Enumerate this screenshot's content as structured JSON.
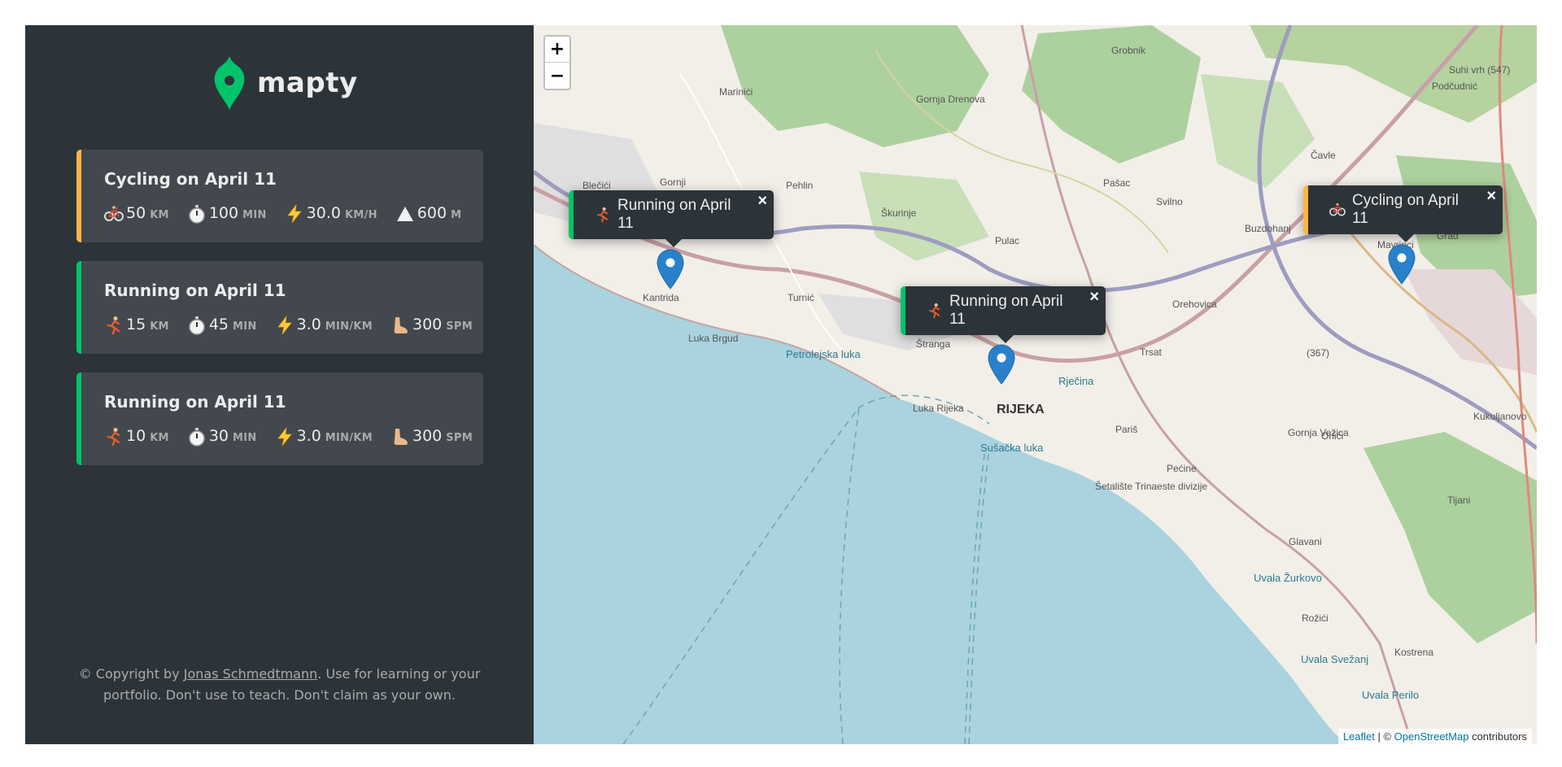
{
  "brand": {
    "name": "mapty"
  },
  "workouts": [
    {
      "type": "cycling",
      "title": "Cycling on April 11",
      "details": [
        {
          "icon": "bicycle-icon",
          "value": "50",
          "unit": "km"
        },
        {
          "icon": "stopwatch-icon",
          "value": "100",
          "unit": "min"
        },
        {
          "icon": "lightning-icon",
          "value": "30.0",
          "unit": "km/h"
        },
        {
          "icon": "mountain-icon",
          "value": "600",
          "unit": "m"
        }
      ]
    },
    {
      "type": "running",
      "title": "Running on April 11",
      "details": [
        {
          "icon": "runner-icon",
          "value": "15",
          "unit": "km"
        },
        {
          "icon": "stopwatch-icon",
          "value": "45",
          "unit": "min"
        },
        {
          "icon": "lightning-icon",
          "value": "3.0",
          "unit": "min/km"
        },
        {
          "icon": "foot-icon",
          "value": "300",
          "unit": "spm"
        }
      ]
    },
    {
      "type": "running",
      "title": "Running on April 11",
      "details": [
        {
          "icon": "runner-icon",
          "value": "10",
          "unit": "km"
        },
        {
          "icon": "stopwatch-icon",
          "value": "30",
          "unit": "min"
        },
        {
          "icon": "lightning-icon",
          "value": "3.0",
          "unit": "min/km"
        },
        {
          "icon": "foot-icon",
          "value": "300",
          "unit": "spm"
        }
      ]
    }
  ],
  "copyright": {
    "prefix": "© Copyright by ",
    "author": "Jonas Schmedtmann",
    "suffix": ". Use for learning or your portfolio. Don't use to teach. Don't claim as your own."
  },
  "map": {
    "zoom_in": "+",
    "zoom_out": "−",
    "popups": [
      {
        "type": "running",
        "label": "Running on April 11",
        "close": "×"
      },
      {
        "type": "running",
        "label": "Running on April 11",
        "close": "×"
      },
      {
        "type": "cycling",
        "label": "Cycling on April 11",
        "close": "×"
      }
    ],
    "places": [
      "Grobnik",
      "Podčudnić",
      "Suhi vrh (547)",
      "Marinići",
      "Gornja Drenova",
      "Pehlin",
      "Škurinje",
      "Pašac",
      "Svilno",
      "Buzdohanj",
      "Blečići",
      "Gornji",
      "Kantrida",
      "Turnić",
      "Pulac",
      "Orehovica",
      "Trsat",
      "(367)",
      "Luka Brgud",
      "Petrolejska luka",
      "Luka Rijeka",
      "RIJEKA",
      "Rječina",
      "Sušačka luka",
      "Pariš",
      "Gornja Vežica",
      "Orlići",
      "Kukuljanovo",
      "Pećine",
      "Šetalište Trinaeste divizije",
      "Tijani",
      "Glavani",
      "Uvala Žurkovo",
      "Rožići",
      "Kostrena",
      "Uvala Svežanj",
      "Uvala Perilo",
      "Čavle",
      "Mavrinci",
      "Grad",
      "Štranga"
    ],
    "attribution": {
      "leaflet": "Leaflet",
      "sep": " | © ",
      "osm": "OpenStreetMap",
      "suffix": " contributors"
    }
  },
  "colors": {
    "sidebar": "#2d3439",
    "card": "#42484d",
    "running": "#00c46a",
    "cycling": "#ffb545",
    "water": "#aad3df",
    "marker": "#2a81cb"
  }
}
